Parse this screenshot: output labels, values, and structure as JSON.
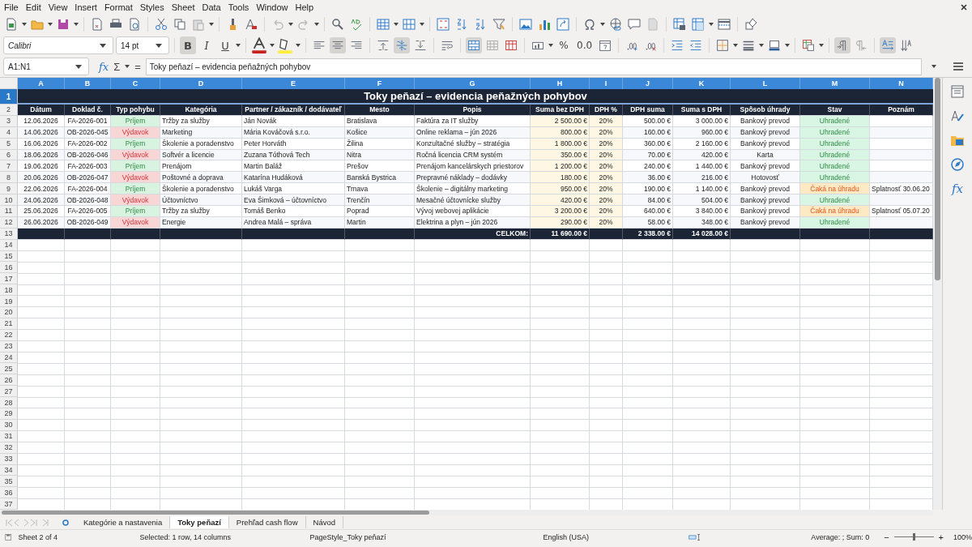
{
  "menu": [
    "File",
    "Edit",
    "View",
    "Insert",
    "Format",
    "Styles",
    "Sheet",
    "Data",
    "Tools",
    "Window",
    "Help"
  ],
  "formatting": {
    "font": "Calibri",
    "size": "14 pt",
    "bold_glyph": "B",
    "italic_glyph": "I",
    "underline_glyph": "U",
    "percent_glyph": "%",
    "number_glyph": "0.0",
    "toggles": {
      "bold": true,
      "align_center": true,
      "valign_middle": true,
      "merge": true,
      "paragraph_ltr": true,
      "text_ltr": true
    }
  },
  "formula_bar": {
    "name_box": "A1:N1",
    "fx": "fx",
    "sum": "Σ",
    "equals": "=",
    "value": "Toky peňazí – evidencia peňažných pohybov"
  },
  "sidebar": {
    "functions": "fx"
  },
  "columns": [
    "A",
    "B",
    "C",
    "D",
    "E",
    "F",
    "G",
    "H",
    "I",
    "J",
    "K",
    "L",
    "M",
    "N"
  ],
  "row_numbers": [
    "1",
    "2",
    "3",
    "4",
    "5",
    "6",
    "7",
    "8",
    "9",
    "10",
    "11",
    "12",
    "13",
    "14",
    "15",
    "16",
    "17",
    "18",
    "19",
    "20",
    "21",
    "22",
    "23",
    "24",
    "25",
    "26",
    "27",
    "28",
    "29",
    "30",
    "31",
    "32",
    "33",
    "34",
    "35",
    "36",
    "37"
  ],
  "title": "Toky peňazí – evidencia peňažných pohybov",
  "headers": [
    "Dátum",
    "Doklad č.",
    "Typ pohybu",
    "Kategória",
    "Partner / zákazník / dodávateľ",
    "Mesto",
    "Popis",
    "Suma bez DPH",
    "DPH %",
    "DPH suma",
    "Suma s DPH",
    "Spôsob úhrady",
    "Stav",
    "Poznám"
  ],
  "rows": [
    {
      "date": "12.06.2026",
      "doc": "FA-2026-001",
      "type": {
        "text": "Príjem",
        "kind": "income"
      },
      "category": "Tržby za služby",
      "partner": "Ján Novák",
      "city": "Bratislava",
      "description": "Faktúra za IT služby",
      "net": "2 500.00 €",
      "vat": "20%",
      "vat_amount": "500.00 €",
      "gross": "3 000.00 €",
      "payment": "Bankový prevod",
      "status": {
        "text": "Uhradené",
        "kind": "paid"
      }
    },
    {
      "date": "14.06.2026",
      "doc": "OB-2026-045",
      "type": {
        "text": "Výdavok",
        "kind": "expense"
      },
      "category": "Marketing",
      "partner": "Mária Kováčová s.r.o.",
      "city": "Košice",
      "description": "Online reklama – jún 2026",
      "net": "800.00 €",
      "vat": "20%",
      "vat_amount": "160.00 €",
      "gross": "960.00 €",
      "payment": "Bankový prevod",
      "status": {
        "text": "Uhradené",
        "kind": "paid"
      }
    },
    {
      "date": "16.06.2026",
      "doc": "FA-2026-002",
      "type": {
        "text": "Príjem",
        "kind": "income"
      },
      "category": "Školenie a poradenstvo",
      "partner": "Peter Horváth",
      "city": "Žilina",
      "description": "Konzultačné služby – stratégia",
      "net": "1 800.00 €",
      "vat": "20%",
      "vat_amount": "360.00 €",
      "gross": "2 160.00 €",
      "payment": "Bankový prevod",
      "status": {
        "text": "Uhradené",
        "kind": "paid"
      }
    },
    {
      "date": "18.06.2026",
      "doc": "OB-2026-046",
      "type": {
        "text": "Výdavok",
        "kind": "expense"
      },
      "category": "Softvér a licencie",
      "partner": "Zuzana Tóthová Tech",
      "city": "Nitra",
      "description": "Ročná licencia CRM systém",
      "net": "350.00 €",
      "vat": "20%",
      "vat_amount": "70.00 €",
      "gross": "420.00 €",
      "payment": "Karta",
      "status": {
        "text": "Uhradené",
        "kind": "paid"
      }
    },
    {
      "date": "19.06.2026",
      "doc": "FA-2026-003",
      "type": {
        "text": "Príjem",
        "kind": "income"
      },
      "category": "Prenájom",
      "partner": "Martin Baláž",
      "city": "Prešov",
      "description": "Prenájom kancelárskych priestorov",
      "net": "1 200.00 €",
      "vat": "20%",
      "vat_amount": "240.00 €",
      "gross": "1 440.00 €",
      "payment": "Bankový prevod",
      "status": {
        "text": "Uhradené",
        "kind": "paid"
      }
    },
    {
      "date": "20.06.2026",
      "doc": "OB-2026-047",
      "type": {
        "text": "Výdavok",
        "kind": "expense"
      },
      "category": "Poštovné a doprava",
      "partner": "Katarína Hudáková",
      "city": "Banská Bystrica",
      "description": "Prepravné náklady – dodávky",
      "net": "180.00 €",
      "vat": "20%",
      "vat_amount": "36.00 €",
      "gross": "216.00 €",
      "payment": "Hotovosť",
      "status": {
        "text": "Uhradené",
        "kind": "paid"
      }
    },
    {
      "date": "22.06.2026",
      "doc": "FA-2026-004",
      "type": {
        "text": "Príjem",
        "kind": "income"
      },
      "category": "Školenie a poradenstvo",
      "partner": "Lukáš Varga",
      "city": "Trnava",
      "description": "Školenie – digitálny marketing",
      "net": "950.00 €",
      "vat": "20%",
      "vat_amount": "190.00 €",
      "gross": "1 140.00 €",
      "payment": "Bankový prevod",
      "status": {
        "text": "Čaká na úhradu",
        "kind": "pending"
      },
      "note": "Splatnosť 30.06.20"
    },
    {
      "date": "24.06.2026",
      "doc": "OB-2026-048",
      "type": {
        "text": "Výdavok",
        "kind": "expense"
      },
      "category": "Účtovníctvo",
      "partner": "Eva Šimková – účtovníctvo",
      "city": "Trenčín",
      "description": "Mesačné účtovnícke služby",
      "net": "420.00 €",
      "vat": "20%",
      "vat_amount": "84.00 €",
      "gross": "504.00 €",
      "payment": "Bankový prevod",
      "status": {
        "text": "Uhradené",
        "kind": "paid"
      }
    },
    {
      "date": "25.06.2026",
      "doc": "FA-2026-005",
      "type": {
        "text": "Príjem",
        "kind": "income"
      },
      "category": "Tržby za služby",
      "partner": "Tomáš Benko",
      "city": "Poprad",
      "description": "Vývoj webovej aplikácie",
      "net": "3 200.00 €",
      "vat": "20%",
      "vat_amount": "640.00 €",
      "gross": "3 840.00 €",
      "payment": "Bankový prevod",
      "status": {
        "text": "Čaká na úhradu",
        "kind": "pending"
      },
      "note": "Splatnosť 05.07.20"
    },
    {
      "date": "26.06.2026",
      "doc": "OB-2026-049",
      "type": {
        "text": "Výdavok",
        "kind": "expense"
      },
      "category": "Energie",
      "partner": "Andrea Malá – správa",
      "city": "Martin",
      "description": "Elektrina a plyn – jún 2026",
      "net": "290.00 €",
      "vat": "20%",
      "vat_amount": "58.00 €",
      "gross": "348.00 €",
      "payment": "Bankový prevod",
      "status": {
        "text": "Uhradené",
        "kind": "paid"
      }
    }
  ],
  "totals": {
    "label": "CELKOM:",
    "net": "11 690.00 €",
    "vat_amount": "2 338.00 €",
    "gross": "14 028.00 €"
  },
  "sheet_tabs": [
    {
      "label": "Kategórie a nastavenia",
      "selected": false
    },
    {
      "label": "Toky peňazí",
      "selected": true
    },
    {
      "label": "Prehľad cash flow",
      "selected": false
    },
    {
      "label": "Návod",
      "selected": false
    }
  ],
  "status_bar": {
    "sheet": "Sheet 2 of 4",
    "selection": "Selected: 1 row, 14 columns",
    "page_style": "PageStyle_Toky peňazí",
    "language": "English (USA)",
    "summary": "Average: ; Sum: 0",
    "zoom_out": "−",
    "zoom_in": "+",
    "zoom_slider": {
      "level": 0.5
    },
    "zoom": "100%"
  }
}
